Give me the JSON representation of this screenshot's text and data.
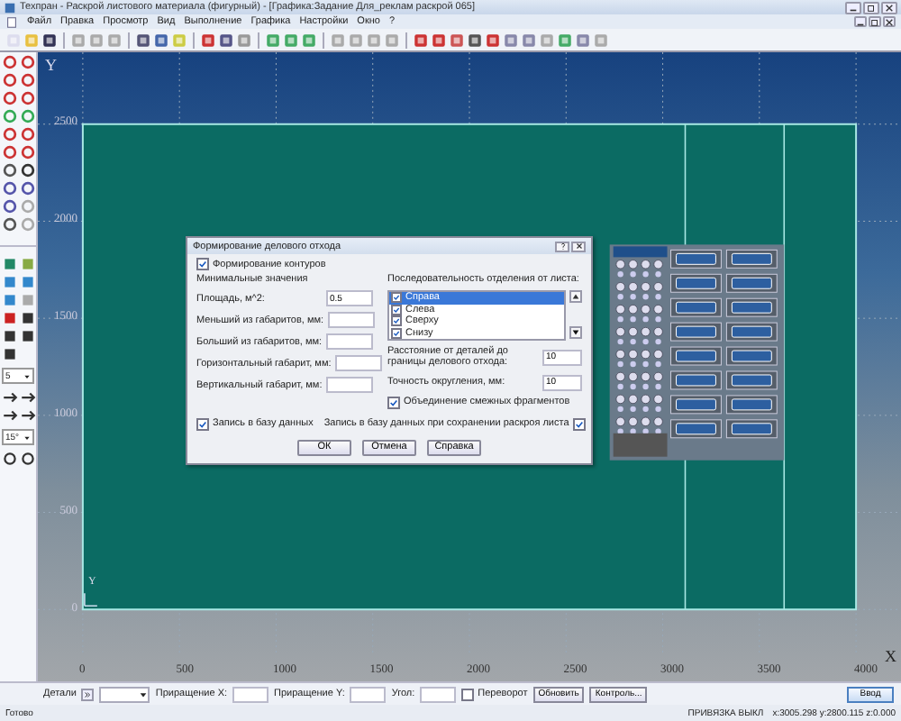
{
  "window": {
    "title": "Техпран - Раскрой листового материала (фигурный) - [Графика:Задание Для_реклам раскрой 065]"
  },
  "menu": [
    "Файл",
    "Правка",
    "Просмотр",
    "Вид",
    "Выполнение",
    "Графика",
    "Настройки",
    "Окно",
    "?"
  ],
  "left_toolbar": {
    "selects": [
      "5",
      "15°"
    ]
  },
  "canvas": {
    "axis_y": "Y",
    "axis_x": "X",
    "origin_mark": "Y",
    "y_ticks": [
      "2500",
      "2000",
      "1500",
      "1000",
      "500",
      "0"
    ],
    "x_ticks": [
      "0",
      "500",
      "1000",
      "1500",
      "2000",
      "2500",
      "3000",
      "3500",
      "4000"
    ]
  },
  "dialog": {
    "title": "Формирование делового отхода",
    "form_contours": {
      "label": "Формирование контуров",
      "checked": true
    },
    "min_heading": "Минимальные значения",
    "fields": [
      {
        "label": "Площадь, м^2:",
        "value": "0.5"
      },
      {
        "label": "Меньший из габаритов, мм:"
      },
      {
        "label": "Больший из габаритов, мм:"
      },
      {
        "label": "Горизонтальный габарит, мм:"
      },
      {
        "label": "Вертикальный габарит, мм:"
      }
    ],
    "order_heading": "Последовательность отделения от листа:",
    "order": [
      {
        "label": "Справа",
        "checked": true,
        "selected": true
      },
      {
        "label": "Слева",
        "checked": true,
        "selected": false
      },
      {
        "label": "Сверху",
        "checked": true,
        "selected": false
      },
      {
        "label": "Снизу",
        "checked": true,
        "selected": false
      }
    ],
    "distance": {
      "label": "Расстояние от деталей до границы делового отхода:",
      "value": "10"
    },
    "precision": {
      "label": "Точность округления, мм:",
      "value": "10"
    },
    "merge": {
      "label": "Объединение смежных фрагментов",
      "checked": true
    },
    "db_write": {
      "label": "Запись в базу данных",
      "checked": true
    },
    "db_write_save": {
      "label": "Запись в базу данных при сохранении раскроя листа",
      "checked": true
    },
    "buttons": [
      "ОК",
      "Отмена",
      "Справка"
    ]
  },
  "bottom_bar": {
    "details_label": "Детали",
    "inc_x": "Приращение X:",
    "inc_y": "Приращение Y:",
    "angle": "Угол:",
    "flip": {
      "label": "Переворот",
      "checked": false
    },
    "buttons": [
      "Обновить",
      "Контроль..."
    ],
    "enter": "Ввод"
  },
  "status_bar": {
    "state": "Готово",
    "snap": "ПРИВЯЗКА ВЫКЛ",
    "coords": "x:3005.298 y:2800.115 z:0.000"
  }
}
